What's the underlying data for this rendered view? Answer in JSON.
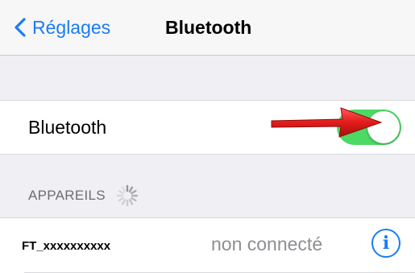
{
  "colors": {
    "accent": "#1a7cf5",
    "toggle_on": "#4cd964",
    "annotation_arrow": "#e31b1b",
    "background": "#efeff4"
  },
  "navbar": {
    "back_label": "Réglages",
    "back_icon": "chevron-left-icon",
    "title": "Bluetooth"
  },
  "bluetooth_row": {
    "label": "Bluetooth",
    "toggle_on": true
  },
  "devices_section": {
    "header": "APPAREILS",
    "spinner_icon": "loading-spinner-icon"
  },
  "devices": [
    {
      "name": "FT_xxxxxxxxxx",
      "status": "non connecté",
      "info_icon": "info-icon",
      "info_glyph": "i"
    }
  ]
}
